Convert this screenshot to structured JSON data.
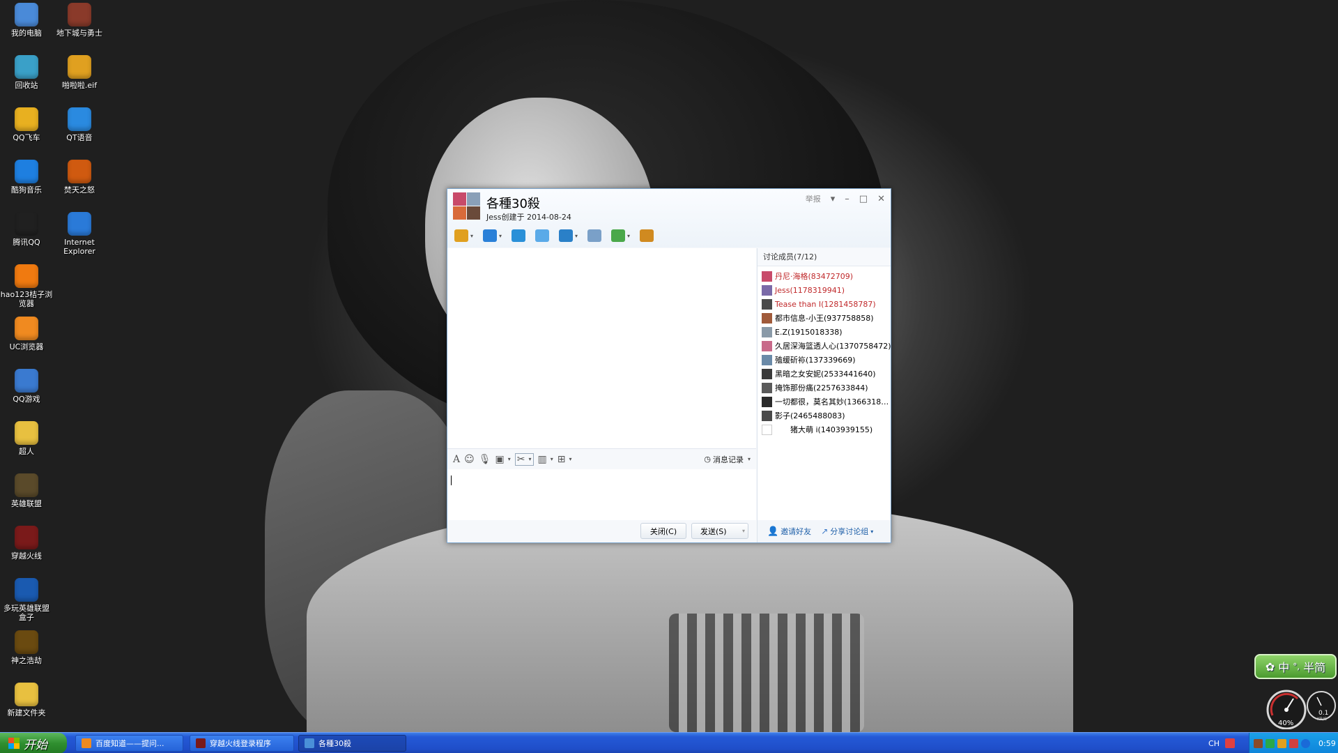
{
  "desktop": {
    "icons": [
      {
        "label": "我的电脑",
        "icon": "computer-icon",
        "color": "#4a8ad8"
      },
      {
        "label": "地下城与勇士",
        "icon": "dnf-game-icon",
        "color": "#8a3a2a"
      },
      {
        "label": "回收站",
        "icon": "recycle-bin-icon",
        "color": "#3aa0c8"
      },
      {
        "label": "啪啦啦.eif",
        "icon": "eif-file-icon",
        "color": "#e0a020"
      },
      {
        "label": "QQ飞车",
        "icon": "qq-speed-icon",
        "color": "#e8b020"
      },
      {
        "label": "QT语音",
        "icon": "qt-voice-icon",
        "color": "#2a8ae0"
      },
      {
        "label": "酷狗音乐",
        "icon": "kugou-icon",
        "color": "#1e7fe0"
      },
      {
        "label": "焚天之怒",
        "icon": "fentian-game-icon",
        "color": "#d05a10"
      },
      {
        "label": "腾讯QQ",
        "icon": "qq-penguin-icon",
        "color": "#202020"
      },
      {
        "label": "Internet Explorer",
        "icon": "internet-explorer-icon",
        "color": "#2a7ad8"
      },
      {
        "label": "hao123桔子浏览器",
        "icon": "orange-browser-icon",
        "color": "#f07a10"
      },
      {
        "label": "UC浏览器",
        "icon": "uc-browser-icon",
        "color": "#f08a20"
      },
      {
        "label": "QQ游戏",
        "icon": "qq-game-icon",
        "color": "#3a7ad0"
      },
      {
        "label": "超人",
        "icon": "folder-icon",
        "color": "#e8c040"
      },
      {
        "label": "英雄联盟",
        "icon": "lol-icon",
        "color": "#5a4a2a"
      },
      {
        "label": "穿越火线",
        "icon": "crossfire-icon",
        "color": "#7a1a1a"
      },
      {
        "label": "多玩英雄联盟盒子",
        "icon": "duowan-box-icon",
        "color": "#1a5ab0"
      },
      {
        "label": "神之浩劫",
        "icon": "smite-icon",
        "color": "#6a4a10"
      },
      {
        "label": "新建文件夹",
        "icon": "folder-icon",
        "color": "#e8c040"
      }
    ]
  },
  "chat": {
    "title": "各種30殺",
    "subtitle": "Jess创建于 2014-08-24",
    "report_label": "举报",
    "toolbar": [
      {
        "icon": "microphone-icon",
        "color": "#e0a020"
      },
      {
        "icon": "video-camera-icon",
        "color": "#2a80d8"
      },
      {
        "icon": "screen-share-icon",
        "color": "#2a90d8"
      },
      {
        "icon": "presentation-icon",
        "color": "#5aaae8"
      },
      {
        "icon": "file-transfer-icon",
        "color": "#2a80c8"
      },
      {
        "icon": "mail-icon",
        "color": "#7aa0c8"
      },
      {
        "icon": "add-app-icon",
        "color": "#4aa84a"
      },
      {
        "icon": "exit-group-icon",
        "color": "#d08a20"
      }
    ],
    "format_bar": {
      "history_label": "消息记录"
    },
    "close_button": "关闭(C)",
    "send_button": "发送(S)",
    "members_header": "讨论成员(7/12)",
    "members": [
      {
        "name": "丹尼·海格(83472709)",
        "color": "#c0282a"
      },
      {
        "name": "Jess(1178319941)",
        "color": "#c0282a"
      },
      {
        "name": "Tease than I(1281458787)",
        "color": "#c0282a"
      },
      {
        "name": "都市信息-小王(937758858)",
        "color": "#000000"
      },
      {
        "name": "E.Z(1915018338)",
        "color": "#000000"
      },
      {
        "name": "久居深海篮透人心(1370758472)",
        "color": "#000000"
      },
      {
        "name": "殖缓斫袮(137339669)",
        "color": "#000000"
      },
      {
        "name": "黑暗之女安妮(2533441640)",
        "color": "#000000"
      },
      {
        "name": "掩饰那份痛(2257633844)",
        "color": "#000000"
      },
      {
        "name": "一切都很，莫名其妙(1366318…",
        "color": "#000000"
      },
      {
        "name": "影子(2465488083)",
        "color": "#000000"
      },
      {
        "name": "猪大萌 i(1403939155)",
        "color": "#000000"
      }
    ],
    "invite_label": "邀请好友",
    "share_label": "分享讨论组"
  },
  "taskbar": {
    "start_label": "开始",
    "tasks": [
      {
        "label": "百度知道——提问...",
        "icon": "browser-task-icon",
        "color": "#f08a20"
      },
      {
        "label": "穿越火线登录程序",
        "icon": "crossfire-task-icon",
        "color": "#7a1a1a"
      },
      {
        "label": "各種30殺",
        "icon": "chat-task-icon",
        "color": "#4a90d8"
      }
    ],
    "lang": "CH",
    "clock": "0:59"
  },
  "ime": {
    "label": "中",
    "mode": "半简"
  },
  "gauge": {
    "percent_label": "40%",
    "speed_label": "0.1",
    "speed_unit": "KB/S"
  }
}
